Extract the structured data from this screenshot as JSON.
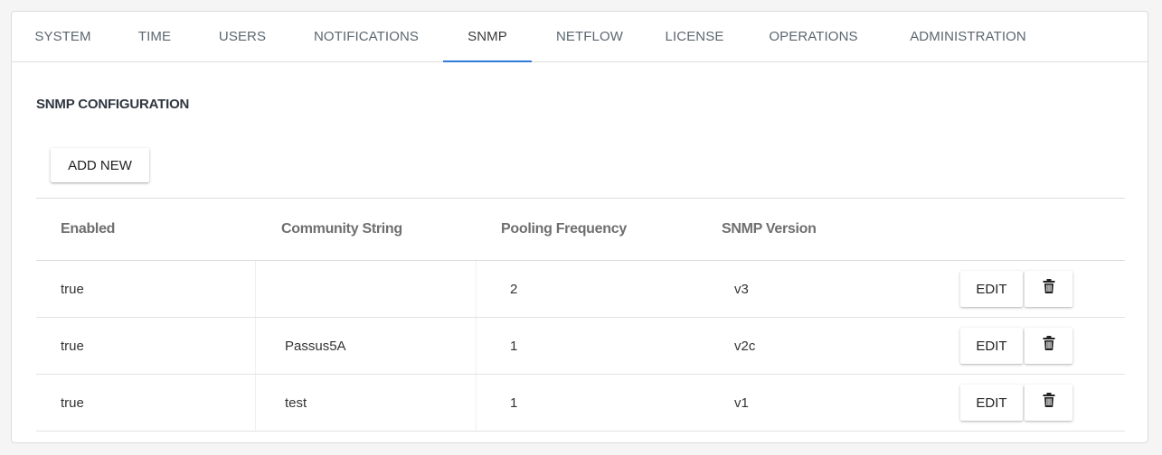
{
  "tabs": [
    {
      "label": "SYSTEM",
      "active": false
    },
    {
      "label": "TIME",
      "active": false
    },
    {
      "label": "USERS",
      "active": false
    },
    {
      "label": "NOTIFICATIONS",
      "active": false
    },
    {
      "label": "SNMP",
      "active": true
    },
    {
      "label": "NETFLOW",
      "active": false
    },
    {
      "label": "LICENSE",
      "active": false
    },
    {
      "label": "OPERATIONS",
      "active": false
    },
    {
      "label": "ADMINISTRATION",
      "active": false
    }
  ],
  "section": {
    "title": "SNMP CONFIGURATION",
    "add_button_label": "ADD NEW"
  },
  "table": {
    "columns": [
      "Enabled",
      "Community String",
      "Pooling Frequency",
      "SNMP Version"
    ],
    "rows": [
      {
        "enabled": "true",
        "community": "",
        "frequency": "2",
        "version": "v3"
      },
      {
        "enabled": "true",
        "community": "Passus5A",
        "frequency": "1",
        "version": "v2c"
      },
      {
        "enabled": "true",
        "community": "test",
        "frequency": "1",
        "version": "v1"
      }
    ],
    "edit_label": "EDIT",
    "delete_icon": "trash-icon"
  },
  "colors": {
    "accent": "#2f7bd8",
    "header_text": "#6f6f6f"
  }
}
